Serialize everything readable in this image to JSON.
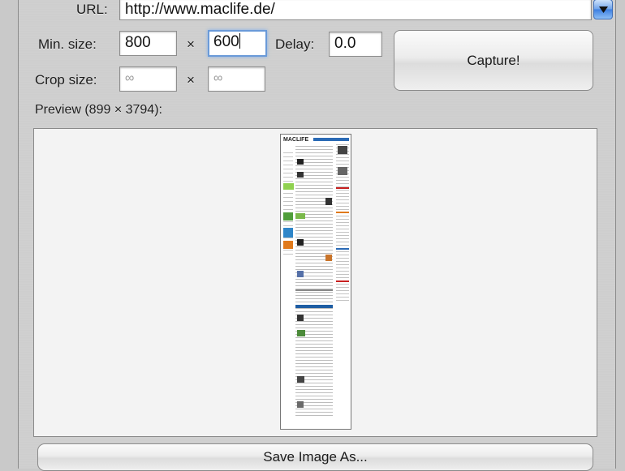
{
  "url": {
    "label": "URL:",
    "value": "http://www.maclife.de/"
  },
  "min_size": {
    "label": "Min. size:",
    "width": "800",
    "times": "×",
    "height": "600"
  },
  "delay": {
    "label": "Delay:",
    "value": "0.0"
  },
  "crop_size": {
    "label": "Crop size:",
    "width_placeholder": "∞",
    "times": "×",
    "height_placeholder": "∞"
  },
  "capture_button": {
    "label": "Capture!"
  },
  "preview": {
    "label": "Preview (899 × 3794):",
    "thumbnail_logo": "MACLIFE"
  },
  "save_button": {
    "label": "Save Image As..."
  }
}
